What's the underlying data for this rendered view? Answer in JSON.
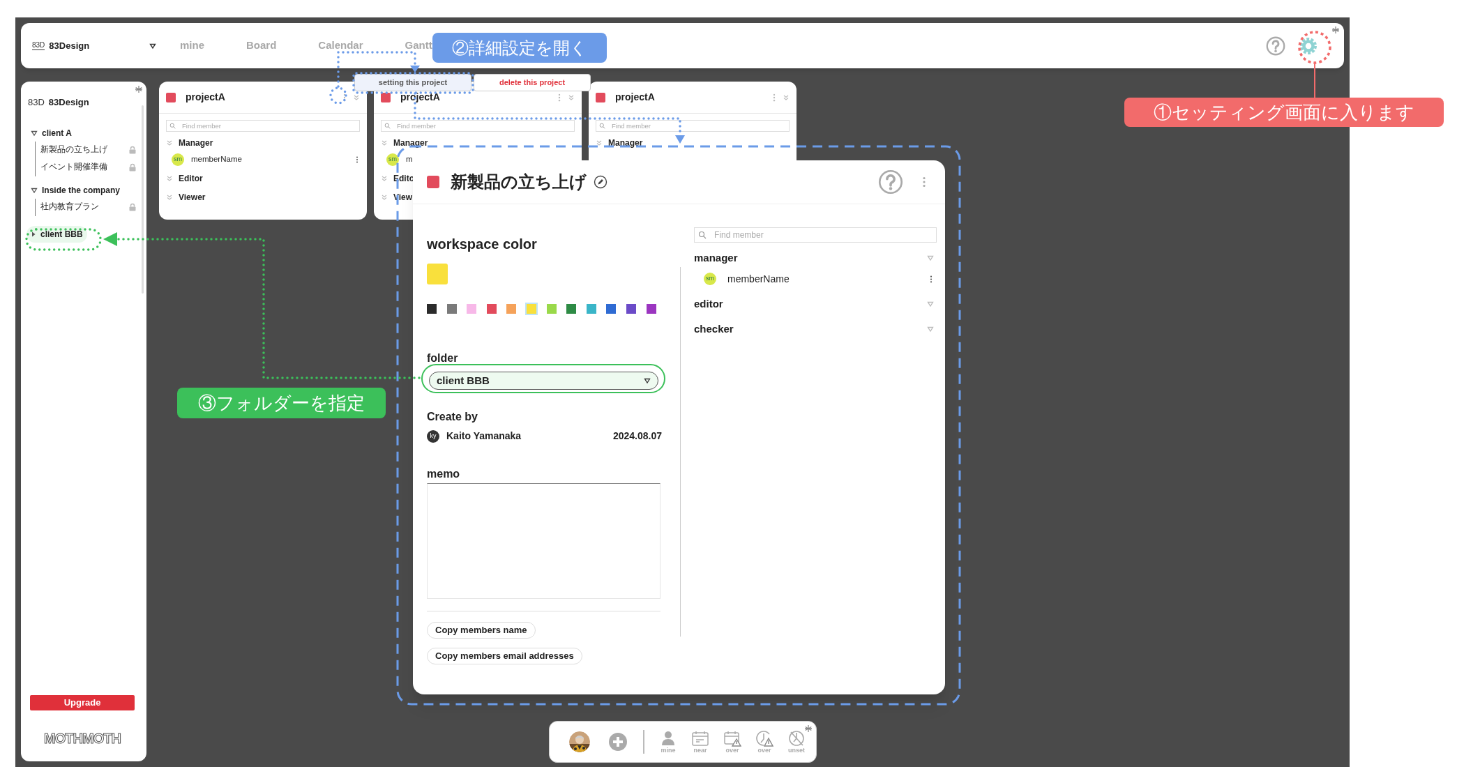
{
  "top_bar": {
    "logo": "83D",
    "workspace": "83Design",
    "nav_tabs": [
      "mine",
      "Board",
      "Calendar",
      "Gantt"
    ]
  },
  "sidebar": {
    "logo": "83D",
    "workspace": "83Design",
    "folders": [
      {
        "name": "client A",
        "expanded": true,
        "highlighted": false,
        "children": [
          {
            "name": "新製品の立ち上げ",
            "locked": true
          },
          {
            "name": "イベント開催準備",
            "locked": true
          }
        ]
      },
      {
        "name": "Inside the company",
        "expanded": true,
        "highlighted": false,
        "children": [
          {
            "name": "社内教育プラン",
            "locked": true
          }
        ]
      },
      {
        "name": "client BBB",
        "expanded": false,
        "highlighted": true
      }
    ],
    "upgrade_button": "Upgrade",
    "brand": "MOTHMOTH"
  },
  "project_cards": [
    {
      "name": "projectA",
      "color": "#e24b5c",
      "search_placeholder": "Find member",
      "groups": [
        {
          "name": "Manager",
          "members": [
            {
              "initials": "sm",
              "name": "memberName",
              "has_menu": true
            }
          ]
        },
        {
          "name": "Editor"
        },
        {
          "name": "Viewer"
        }
      ]
    },
    {
      "name": "projectA",
      "color": "#e24b5c",
      "search_placeholder": "Find member",
      "groups": [
        {
          "name": "Manager",
          "members": [
            {
              "initials": "sm",
              "name": "m"
            }
          ]
        },
        {
          "name": "Edito"
        },
        {
          "name": "View"
        }
      ]
    },
    {
      "name": "projectA",
      "color": "#e24b5c",
      "search_placeholder": "Find member",
      "groups": [
        {
          "name": "Manager"
        }
      ]
    }
  ],
  "project_menu": [
    {
      "label": "setting this project",
      "kind": "normal"
    },
    {
      "label": "delete this project",
      "kind": "danger"
    }
  ],
  "modal": {
    "color": "#e24b5c",
    "title": "新製品の立ち上げ",
    "workspace_color_label": "workspace color",
    "palette": [
      {
        "color": "#2b2b2b",
        "selected": false
      },
      {
        "color": "#7a7a7a",
        "selected": false
      },
      {
        "color": "#f7b8e8",
        "selected": false
      },
      {
        "color": "#e24b5c",
        "selected": false
      },
      {
        "color": "#f5a25a",
        "selected": false
      },
      {
        "color": "#f9e03c",
        "selected": true
      },
      {
        "color": "#9ad94a",
        "selected": false
      },
      {
        "color": "#2e8b45",
        "selected": false
      },
      {
        "color": "#3ab5c8",
        "selected": false
      },
      {
        "color": "#2f6bd3",
        "selected": false
      },
      {
        "color": "#6b4bc8",
        "selected": false
      },
      {
        "color": "#9b35c0",
        "selected": false
      }
    ],
    "folder_label": "folder",
    "folder_value": "client BBB",
    "created_label": "Create by",
    "creator_initials": "ky",
    "creator": "Kaito Yamanaka",
    "created_date": "2024.08.07",
    "memo_label": "memo",
    "buttons": [
      "Copy members name",
      "Copy members email addresses"
    ],
    "search_placeholder": "Find member",
    "roles": [
      {
        "name": "manager",
        "members": [
          {
            "initials": "sm",
            "name": "memberName"
          }
        ]
      },
      {
        "name": "editor"
      },
      {
        "name": "checker"
      }
    ]
  },
  "dock": {
    "items": [
      {
        "kind": "person",
        "label": "mine"
      },
      {
        "kind": "calendar",
        "label": "near"
      },
      {
        "kind": "calendar_warning",
        "label": "over"
      },
      {
        "kind": "clock_warning",
        "label": "over"
      },
      {
        "kind": "clock_unset",
        "label": "unset"
      }
    ]
  },
  "annotations": [
    {
      "text": "②詳細設定を開く",
      "color": "#6b9be8"
    },
    {
      "text": "①セッティング画面に入ります",
      "color": "#f26b6b"
    },
    {
      "text": "③フォルダーを指定",
      "color": "#3cc05a"
    }
  ]
}
